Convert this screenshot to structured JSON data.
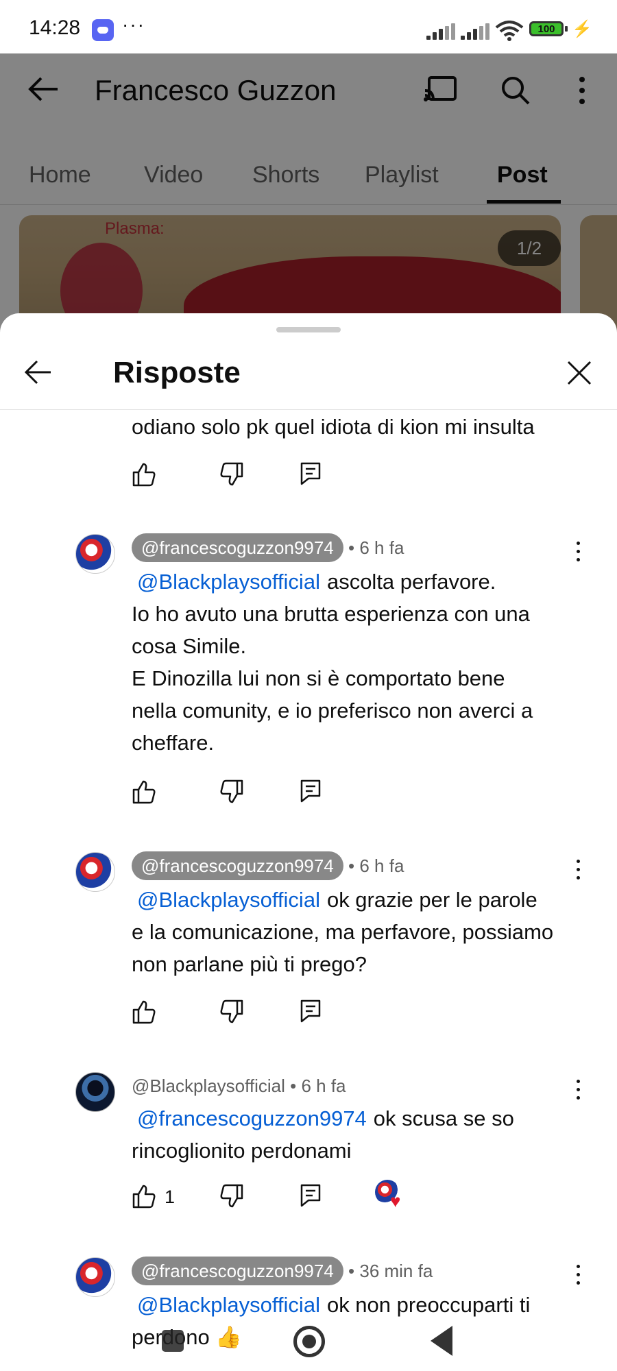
{
  "status_bar": {
    "time": "14:28",
    "dots": "···",
    "battery": "100"
  },
  "channel": {
    "title": "Francesco Guzzon",
    "tabs": [
      "Home",
      "Video",
      "Shorts",
      "Playlist",
      "Post"
    ],
    "active_tab": "Post",
    "post_image_counter": "1/2",
    "post_image_caption": "Plasma:"
  },
  "sheet": {
    "title": "Risposte"
  },
  "comments": [
    {
      "text": "odiano solo pk  quel idiota di kion mi insulta"
    },
    {
      "author": "@francescoguzzon9974",
      "time": "• 6 h fa",
      "mention": "@Blackplaysofficial",
      "lines": [
        "ascolta perfavore.",
        "Io ho avuto una brutta esperienza con una",
        "cosa Simile.",
        "E Dinozilla lui non si è comportato bene",
        "nella comunity, e io preferisco non averci a",
        "cheffare."
      ]
    },
    {
      "author": "@francescoguzzon9974",
      "time": "• 6 h fa",
      "mention": "@Blackplaysofficial",
      "lines": [
        "ok grazie per le parole",
        "e la comunicazione, ma perfavore, possiamo",
        "non parlane più ti prego?"
      ]
    },
    {
      "author": "@Blackplaysofficial",
      "time": "• 6 h fa",
      "mention": "@francescoguzzon9974",
      "lines": [
        "ok scusa se so",
        "rincoglionito perdonami"
      ],
      "likes": "1"
    },
    {
      "author": "@francescoguzzon9974",
      "time": "• 36 min fa",
      "mention": "@Blackplaysofficial",
      "lines": [
        "ok non preoccuparti ti",
        "perdono 👍"
      ]
    }
  ],
  "colors": {
    "link": "#065fd4",
    "chip": "#888888",
    "heart": "#e0182d"
  }
}
